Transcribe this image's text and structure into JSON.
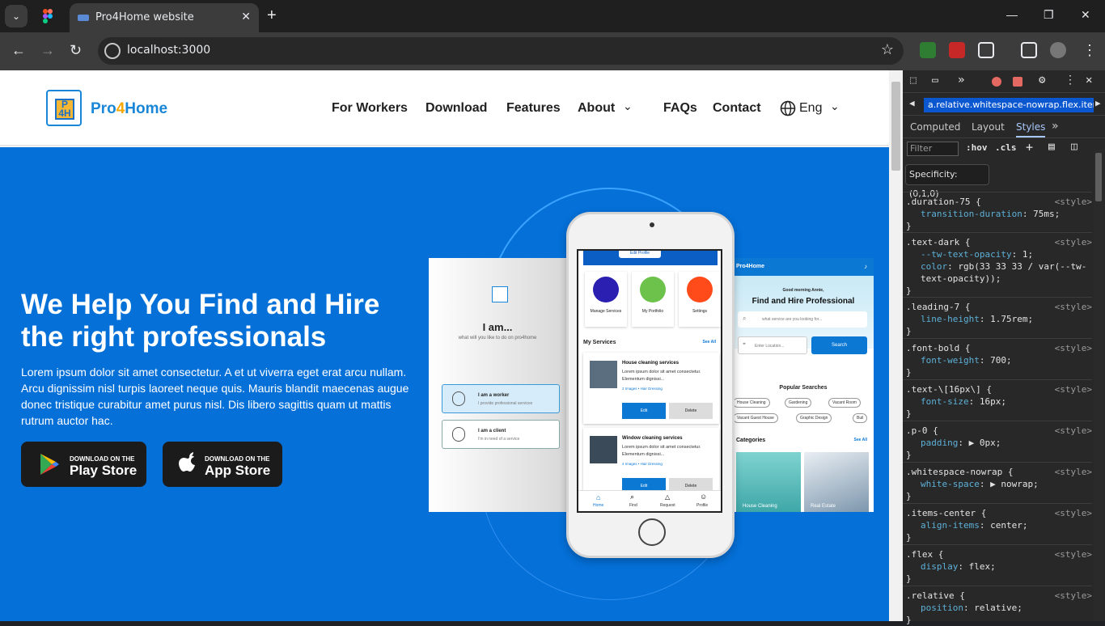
{
  "browser": {
    "tab_title": "Pro4Home website",
    "url": "localhost:3000",
    "newtab_label": "+",
    "close_label": "✕"
  },
  "site": {
    "logo_main": "Pro",
    "logo_four": "4",
    "logo_end": "Home",
    "nav": {
      "workers": "For Workers",
      "download": "Download",
      "features": "Features",
      "about": "About",
      "faqs": "FAQs",
      "contact": "Contact",
      "lang": "Eng"
    },
    "hero": {
      "title": "We Help You Find and Hire the right professionals",
      "body": "Lorem ipsum dolor sit amet consectetur. A et ut viverra eget erat arcu nullam. Arcu dignissim nisl turpis laoreet neque quis. Mauris blandit maecenas augue donec tristique curabitur amet purus nisl. Dis libero sagittis quam ut mattis rutrum auctor hac."
    },
    "stores": {
      "play_small": "DOWNLOAD ON THE",
      "play_big": "Play Store",
      "app_small": "DOWNLOAD ON THE",
      "app_big": "App Store"
    }
  },
  "mock_left": {
    "title": "I am...",
    "subtitle": "what will you like to do on pro4home",
    "worker_title": "I am a worker",
    "worker_sub": "I provide professional services",
    "client_title": "I am a client",
    "client_sub": "I'm in need of a service"
  },
  "mock_phone": {
    "edit_profile": "Edit Profile",
    "tiles": [
      "Manage Services",
      "My Portfolio",
      "Settings"
    ],
    "my_services": "My Services",
    "see_all": "See All",
    "services": [
      {
        "title": "House cleaning services",
        "desc": "Lorem ipsum dolor sit amet consectetur. Elementum dignissi...",
        "meta": "2 Images • Hair Dressing",
        "edit": "Edit",
        "delete": "Delete"
      },
      {
        "title": "Window cleaning services",
        "desc": "Lorem ipsum dolor sit amet consectetur. Elementum dignissi...",
        "meta": "4 Images • Hair Dressing",
        "edit": "Edit",
        "delete": "Delete"
      }
    ],
    "tabs": [
      "Home",
      "Find",
      "Request",
      "Profile"
    ]
  },
  "mock_right": {
    "brand": "Pro4Home",
    "greeting": "Good morning Annie,",
    "headline": "Find and Hire Professional",
    "search_placeholder": "what service are you looking for...",
    "location_placeholder": "Enter Location...",
    "search_btn": "Search",
    "popular": "Popular Searches",
    "chips": [
      "House Cleaning",
      "Gardening",
      "Vacant Room",
      "Vacant Guest House",
      "Graphic Design",
      "Buil"
    ],
    "categories": "Categories",
    "see_all": "See All",
    "cat_items": [
      "House Cleaning",
      "Real Estate"
    ]
  },
  "devtools": {
    "breadcrumb": "a.relative.whitespace-nowrap.flex.item",
    "tabs": [
      "Computed",
      "Layout",
      "Styles"
    ],
    "filter": "Filter",
    "hov": ":hov",
    "cls": ".cls",
    "specificity": "Specificity: (0,1,0)",
    "rules": [
      {
        "selector": ".duration-75 {",
        "src": "<style>",
        "props": [
          [
            "transition-duration",
            "75ms;"
          ]
        ]
      },
      {
        "selector": ".text-dark {",
        "src": "<style>",
        "props": [
          [
            "--tw-text-opacity",
            "1;"
          ],
          [
            "color",
            "rgb(33 33 33 / var(--tw-text-opacity));"
          ]
        ]
      },
      {
        "selector": ".leading-7 {",
        "src": "<style>",
        "props": [
          [
            "line-height",
            "1.75rem;"
          ]
        ]
      },
      {
        "selector": ".font-bold {",
        "src": "<style>",
        "props": [
          [
            "font-weight",
            "700;"
          ]
        ]
      },
      {
        "selector": ".text-\\[16px\\] {",
        "src": "<style>",
        "props": [
          [
            "font-size",
            "16px;"
          ]
        ]
      },
      {
        "selector": ".p-0 {",
        "src": "<style>",
        "props": [
          [
            "padding",
            "▶ 0px;"
          ]
        ]
      },
      {
        "selector": ".whitespace-nowrap {",
        "src": "<style>",
        "props": [
          [
            "white-space",
            "▶ nowrap;"
          ]
        ]
      },
      {
        "selector": ".items-center {",
        "src": "<style>",
        "props": [
          [
            "align-items",
            "center;"
          ]
        ]
      },
      {
        "selector": ".flex {",
        "src": "<style>",
        "props": [
          [
            "display",
            "flex;"
          ]
        ]
      },
      {
        "selector": ".relative {",
        "src": "<style>",
        "props": [
          [
            "position",
            "relative;"
          ]
        ]
      }
    ],
    "close_brace": "}"
  }
}
